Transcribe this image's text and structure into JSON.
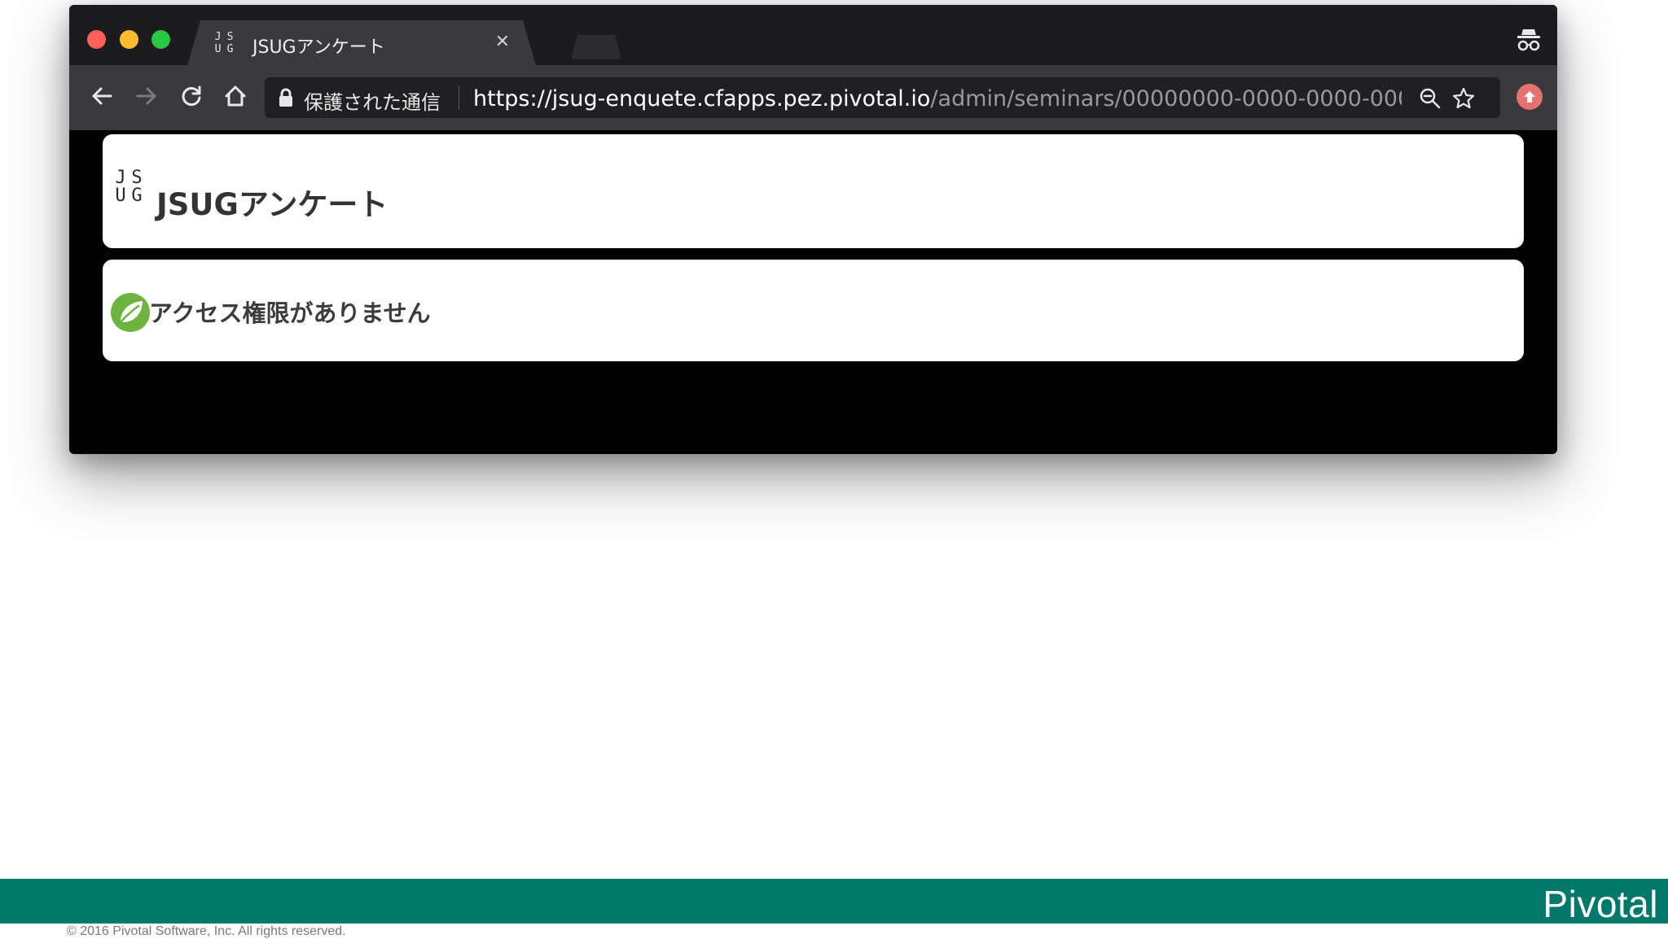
{
  "browser": {
    "tab": {
      "favicon": [
        "J",
        "S",
        "U",
        "G"
      ],
      "title": "JSUGアンケート",
      "close_glyph": "✕"
    },
    "toolbar": {
      "secure_label": "保護された通信",
      "url_main": "https://jsug-enquete.cfapps.pez.pivotal.io",
      "url_path": "/admin/seminars/00000000-0000-0000-000...",
      "icons": [
        "back-arrow-icon",
        "forward-arrow-icon",
        "reload-icon",
        "home-icon",
        "lock-icon",
        "zoom-icon",
        "star-icon",
        "extension-icon",
        "incognito-icon"
      ]
    }
  },
  "page": {
    "header": {
      "logo_letters": [
        "J",
        "S",
        "U",
        "G"
      ],
      "title": "JSUGアンケート"
    },
    "message": {
      "icon": "spring-leaf-icon",
      "text": "アクセス権限がありません"
    }
  },
  "slide": {
    "brand": "Pivotal",
    "copyright": "© 2016 Pivotal Software, Inc.  All rights reserved.",
    "colors": {
      "footer_bar": "#00796b",
      "browser_bg": "#020203",
      "card_bg": "#ffffff"
    }
  }
}
